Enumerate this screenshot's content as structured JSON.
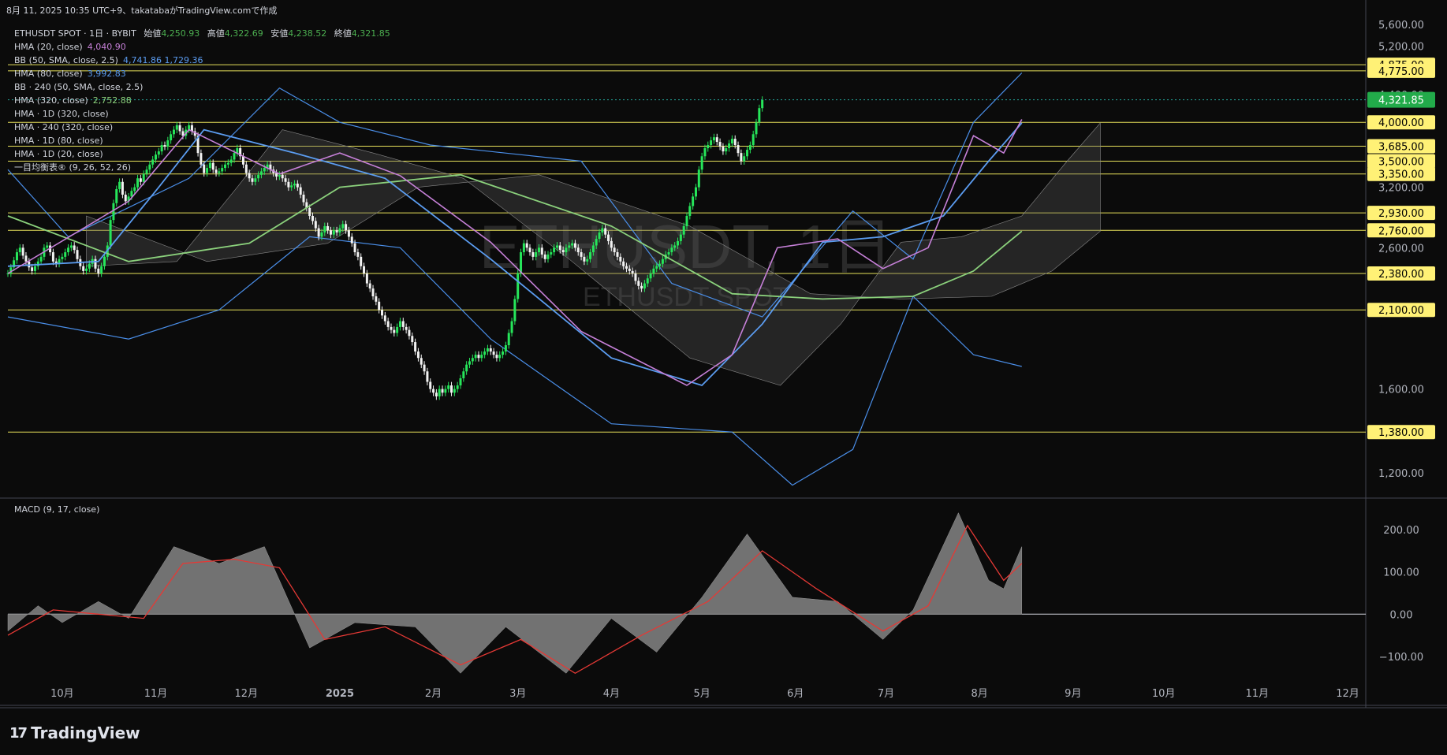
{
  "header": {
    "text": "8月 11, 2025 10:35 UTC+9、takatabaがTradingView.comで作成"
  },
  "watermark": {
    "symbol": "ETHUSDT, 1日",
    "sub": "ETHUSDT SPOT"
  },
  "legend": {
    "main": {
      "label": "ETHUSDT SPOT · 1日 · BYBIT",
      "o_lbl": "始値",
      "o": "4,250.93",
      "h_lbl": "高値",
      "h": "4,322.69",
      "l_lbl": "安値",
      "l": "4,238.52",
      "c_lbl": "終値",
      "c": "4,321.85"
    },
    "rows": [
      {
        "label": "HMA (20, close)",
        "value": "4,040.90",
        "color": "#c680d8"
      },
      {
        "label": "BB (50, SMA, close, 2.5)",
        "value": "4,741.86  1,729.36",
        "color": "#5b9cf0"
      },
      {
        "label": "HMA (80, close)",
        "value": "3,992.83",
        "color": "#5b9cf0"
      },
      {
        "label": "BB · 240 (50, SMA, close, 2.5)",
        "value": "",
        "color": "#d1d4dc"
      },
      {
        "label": "HMA (320, close)",
        "value": "2,752.88",
        "color": "#8bd17c"
      },
      {
        "label": "HMA · 1D (320, close)",
        "value": "",
        "color": "#d1d4dc"
      },
      {
        "label": "HMA · 240 (320, close)",
        "value": "",
        "color": "#d1d4dc"
      },
      {
        "label": "HMA · 1D (80, close)",
        "value": "",
        "color": "#d1d4dc"
      },
      {
        "label": "HMA · 1D (20, close)",
        "value": "",
        "color": "#d1d4dc"
      },
      {
        "label": "一目均衡表® (9, 26, 52, 26)",
        "value": "",
        "color": "#d1d4dc"
      }
    ]
  },
  "macd": {
    "label": "MACD (9, 17, close)"
  },
  "brand": {
    "logo_mark": "17",
    "name": "TradingView"
  },
  "chart_data": {
    "type": "candlestick",
    "symbol": "ETHUSDT SPOT",
    "interval": "1D",
    "price_axis": {
      "ticks": [
        "5,600.00",
        "5,200.00",
        "4,400.00",
        "3,200.00",
        "2,600.00",
        "1,600.00",
        "1,200.00"
      ],
      "tick_values": [
        5600,
        5200,
        4400,
        3200,
        2600,
        1600,
        1200
      ],
      "ylim": [
        1100,
        5800
      ],
      "scale": "log"
    },
    "horizontal_levels": [
      4875,
      4775,
      4000,
      3685,
      3500,
      3350,
      2930,
      2760,
      2380,
      2100,
      1380
    ],
    "level_labels": [
      "4,875.00",
      "4,775.00",
      "4,000.00",
      "3,685.00",
      "3,500.00",
      "3,350.00",
      "2,930.00",
      "2,760.00",
      "2,380.00",
      "2,100.00",
      "1,380.00"
    ],
    "last_price": {
      "value": 4321.85,
      "label": "4,321.85"
    },
    "x_axis": {
      "labels": [
        "10月",
        "11月",
        "12月",
        "2025",
        "2月",
        "3月",
        "4月",
        "5月",
        "6月",
        "7月",
        "8月",
        "9月",
        "10月",
        "11月",
        "12月"
      ],
      "xlim_days": [
        0,
        450
      ],
      "label_days": [
        18,
        49,
        79,
        110,
        141,
        169,
        200,
        230,
        261,
        291,
        322,
        353,
        383,
        414,
        444
      ]
    },
    "candle_start_day": 0,
    "close_series": [
      2380,
      2430,
      2490,
      2560,
      2600,
      2530,
      2480,
      2430,
      2400,
      2440,
      2480,
      2520,
      2600,
      2620,
      2560,
      2480,
      2460,
      2500,
      2520,
      2560,
      2600,
      2620,
      2580,
      2500,
      2440,
      2400,
      2420,
      2460,
      2500,
      2420,
      2380,
      2440,
      2520,
      2620,
      2860,
      3030,
      3180,
      3260,
      3120,
      3050,
      3100,
      3160,
      3200,
      3300,
      3260,
      3350,
      3400,
      3460,
      3520,
      3580,
      3620,
      3700,
      3680,
      3760,
      3840,
      3900,
      3960,
      3880,
      3820,
      3900,
      3960,
      3880,
      3820,
      3600,
      3460,
      3360,
      3420,
      3480,
      3400,
      3360,
      3380,
      3420,
      3460,
      3480,
      3520,
      3600,
      3660,
      3560,
      3460,
      3360,
      3300,
      3260,
      3300,
      3340,
      3380,
      3420,
      3460,
      3400,
      3360,
      3320,
      3340,
      3300,
      3260,
      3200,
      3220,
      3240,
      3200,
      3120,
      3040,
      2980,
      2900,
      2850,
      2780,
      2700,
      2740,
      2800,
      2760,
      2720,
      2760,
      2740,
      2780,
      2820,
      2760,
      2700,
      2640,
      2560,
      2520,
      2440,
      2380,
      2300,
      2260,
      2200,
      2160,
      2100,
      2060,
      2020,
      1980,
      1960,
      1940,
      1980,
      2020,
      1980,
      1960,
      1920,
      1880,
      1820,
      1780,
      1740,
      1700,
      1640,
      1600,
      1580,
      1560,
      1600,
      1580,
      1600,
      1620,
      1580,
      1600,
      1620,
      1660,
      1700,
      1740,
      1760,
      1780,
      1800,
      1780,
      1800,
      1820,
      1840,
      1820,
      1800,
      1780,
      1800,
      1820,
      1860,
      1940,
      2020,
      2180,
      2380,
      2560,
      2640,
      2600,
      2560,
      2520,
      2560,
      2600,
      2540,
      2500,
      2540,
      2560,
      2600,
      2620,
      2580,
      2560,
      2600,
      2620,
      2640,
      2600,
      2560,
      2520,
      2480,
      2500,
      2560,
      2620,
      2680,
      2740,
      2780,
      2720,
      2660,
      2600,
      2560,
      2520,
      2480,
      2440,
      2420,
      2400,
      2380,
      2320,
      2280,
      2260,
      2300,
      2340,
      2380,
      2420,
      2440,
      2460,
      2500,
      2540,
      2560,
      2600,
      2620,
      2660,
      2720,
      2800,
      2900,
      3000,
      3100,
      3200,
      3400,
      3560,
      3660,
      3700,
      3760,
      3800,
      3740,
      3680,
      3620,
      3660,
      3720,
      3780,
      3700,
      3600,
      3500,
      3560,
      3640,
      3700,
      3840,
      4000,
      4200,
      4321.85
    ],
    "sma_series_hma20": [
      {
        "d": 0,
        "v": 2380
      },
      {
        "d": 40,
        "v": 3050
      },
      {
        "d": 60,
        "v": 3900
      },
      {
        "d": 90,
        "v": 3350
      },
      {
        "d": 110,
        "v": 3600
      },
      {
        "d": 130,
        "v": 3330
      },
      {
        "d": 160,
        "v": 2650
      },
      {
        "d": 190,
        "v": 1950
      },
      {
        "d": 225,
        "v": 1620
      },
      {
        "d": 240,
        "v": 1800
      },
      {
        "d": 255,
        "v": 2600
      },
      {
        "d": 275,
        "v": 2680
      },
      {
        "d": 290,
        "v": 2420
      },
      {
        "d": 305,
        "v": 2600
      },
      {
        "d": 320,
        "v": 3820
      },
      {
        "d": 330,
        "v": 3600
      },
      {
        "d": 336,
        "v": 4040
      }
    ],
    "series_hma80": [
      {
        "d": 0,
        "v": 2440
      },
      {
        "d": 30,
        "v": 2480
      },
      {
        "d": 50,
        "v": 3200
      },
      {
        "d": 65,
        "v": 3900
      },
      {
        "d": 95,
        "v": 3600
      },
      {
        "d": 125,
        "v": 3300
      },
      {
        "d": 160,
        "v": 2500
      },
      {
        "d": 200,
        "v": 1780
      },
      {
        "d": 230,
        "v": 1620
      },
      {
        "d": 250,
        "v": 2000
      },
      {
        "d": 270,
        "v": 2650
      },
      {
        "d": 290,
        "v": 2700
      },
      {
        "d": 310,
        "v": 2900
      },
      {
        "d": 325,
        "v": 3500
      },
      {
        "d": 336,
        "v": 3992
      }
    ],
    "series_hma320": [
      {
        "d": 0,
        "v": 2900
      },
      {
        "d": 40,
        "v": 2480
      },
      {
        "d": 80,
        "v": 2640
      },
      {
        "d": 110,
        "v": 3200
      },
      {
        "d": 150,
        "v": 3340
      },
      {
        "d": 200,
        "v": 2800
      },
      {
        "d": 240,
        "v": 2220
      },
      {
        "d": 270,
        "v": 2180
      },
      {
        "d": 300,
        "v": 2200
      },
      {
        "d": 320,
        "v": 2400
      },
      {
        "d": 336,
        "v": 2752
      }
    ],
    "bb_upper": [
      {
        "d": 0,
        "v": 3400
      },
      {
        "d": 20,
        "v": 2700
      },
      {
        "d": 60,
        "v": 3300
      },
      {
        "d": 90,
        "v": 4500
      },
      {
        "d": 110,
        "v": 4000
      },
      {
        "d": 140,
        "v": 3700
      },
      {
        "d": 190,
        "v": 3500
      },
      {
        "d": 220,
        "v": 2300
      },
      {
        "d": 250,
        "v": 2050
      },
      {
        "d": 280,
        "v": 2950
      },
      {
        "d": 300,
        "v": 2500
      },
      {
        "d": 320,
        "v": 4000
      },
      {
        "d": 336,
        "v": 4741
      }
    ],
    "bb_lower": [
      {
        "d": 0,
        "v": 2050
      },
      {
        "d": 40,
        "v": 1900
      },
      {
        "d": 70,
        "v": 2100
      },
      {
        "d": 100,
        "v": 2700
      },
      {
        "d": 130,
        "v": 2600
      },
      {
        "d": 160,
        "v": 1900
      },
      {
        "d": 200,
        "v": 1420
      },
      {
        "d": 240,
        "v": 1380
      },
      {
        "d": 260,
        "v": 1150
      },
      {
        "d": 280,
        "v": 1300
      },
      {
        "d": 300,
        "v": 2200
      },
      {
        "d": 320,
        "v": 1800
      },
      {
        "d": 336,
        "v": 1729
      }
    ],
    "macd": {
      "ylim": [
        -160,
        260
      ],
      "ticks": [
        200,
        100,
        0,
        -100
      ],
      "tick_labels": [
        "200.00",
        "100.00",
        "0.00",
        "−100.00"
      ],
      "hist": [
        {
          "d": 0,
          "v": -40
        },
        {
          "d": 10,
          "v": 20
        },
        {
          "d": 18,
          "v": -20
        },
        {
          "d": 30,
          "v": 30
        },
        {
          "d": 40,
          "v": -10
        },
        {
          "d": 55,
          "v": 160
        },
        {
          "d": 70,
          "v": 120
        },
        {
          "d": 85,
          "v": 160
        },
        {
          "d": 100,
          "v": -80
        },
        {
          "d": 115,
          "v": -20
        },
        {
          "d": 135,
          "v": -30
        },
        {
          "d": 150,
          "v": -140
        },
        {
          "d": 165,
          "v": -30
        },
        {
          "d": 185,
          "v": -140
        },
        {
          "d": 200,
          "v": -10
        },
        {
          "d": 215,
          "v": -90
        },
        {
          "d": 230,
          "v": 40
        },
        {
          "d": 245,
          "v": 190
        },
        {
          "d": 260,
          "v": 40
        },
        {
          "d": 275,
          "v": 30
        },
        {
          "d": 290,
          "v": -60
        },
        {
          "d": 300,
          "v": 10
        },
        {
          "d": 315,
          "v": 240
        },
        {
          "d": 325,
          "v": 80
        },
        {
          "d": 330,
          "v": 60
        },
        {
          "d": 336,
          "v": 160
        }
      ],
      "signal": [
        {
          "d": 0,
          "v": -50
        },
        {
          "d": 15,
          "v": 10
        },
        {
          "d": 30,
          "v": 0
        },
        {
          "d": 45,
          "v": -10
        },
        {
          "d": 58,
          "v": 120
        },
        {
          "d": 75,
          "v": 130
        },
        {
          "d": 90,
          "v": 110
        },
        {
          "d": 105,
          "v": -60
        },
        {
          "d": 125,
          "v": -30
        },
        {
          "d": 150,
          "v": -120
        },
        {
          "d": 170,
          "v": -60
        },
        {
          "d": 188,
          "v": -140
        },
        {
          "d": 210,
          "v": -50
        },
        {
          "d": 232,
          "v": 30
        },
        {
          "d": 250,
          "v": 150
        },
        {
          "d": 268,
          "v": 60
        },
        {
          "d": 290,
          "v": -40
        },
        {
          "d": 305,
          "v": 20
        },
        {
          "d": 318,
          "v": 210
        },
        {
          "d": 330,
          "v": 80
        },
        {
          "d": 336,
          "v": 120
        }
      ]
    }
  }
}
